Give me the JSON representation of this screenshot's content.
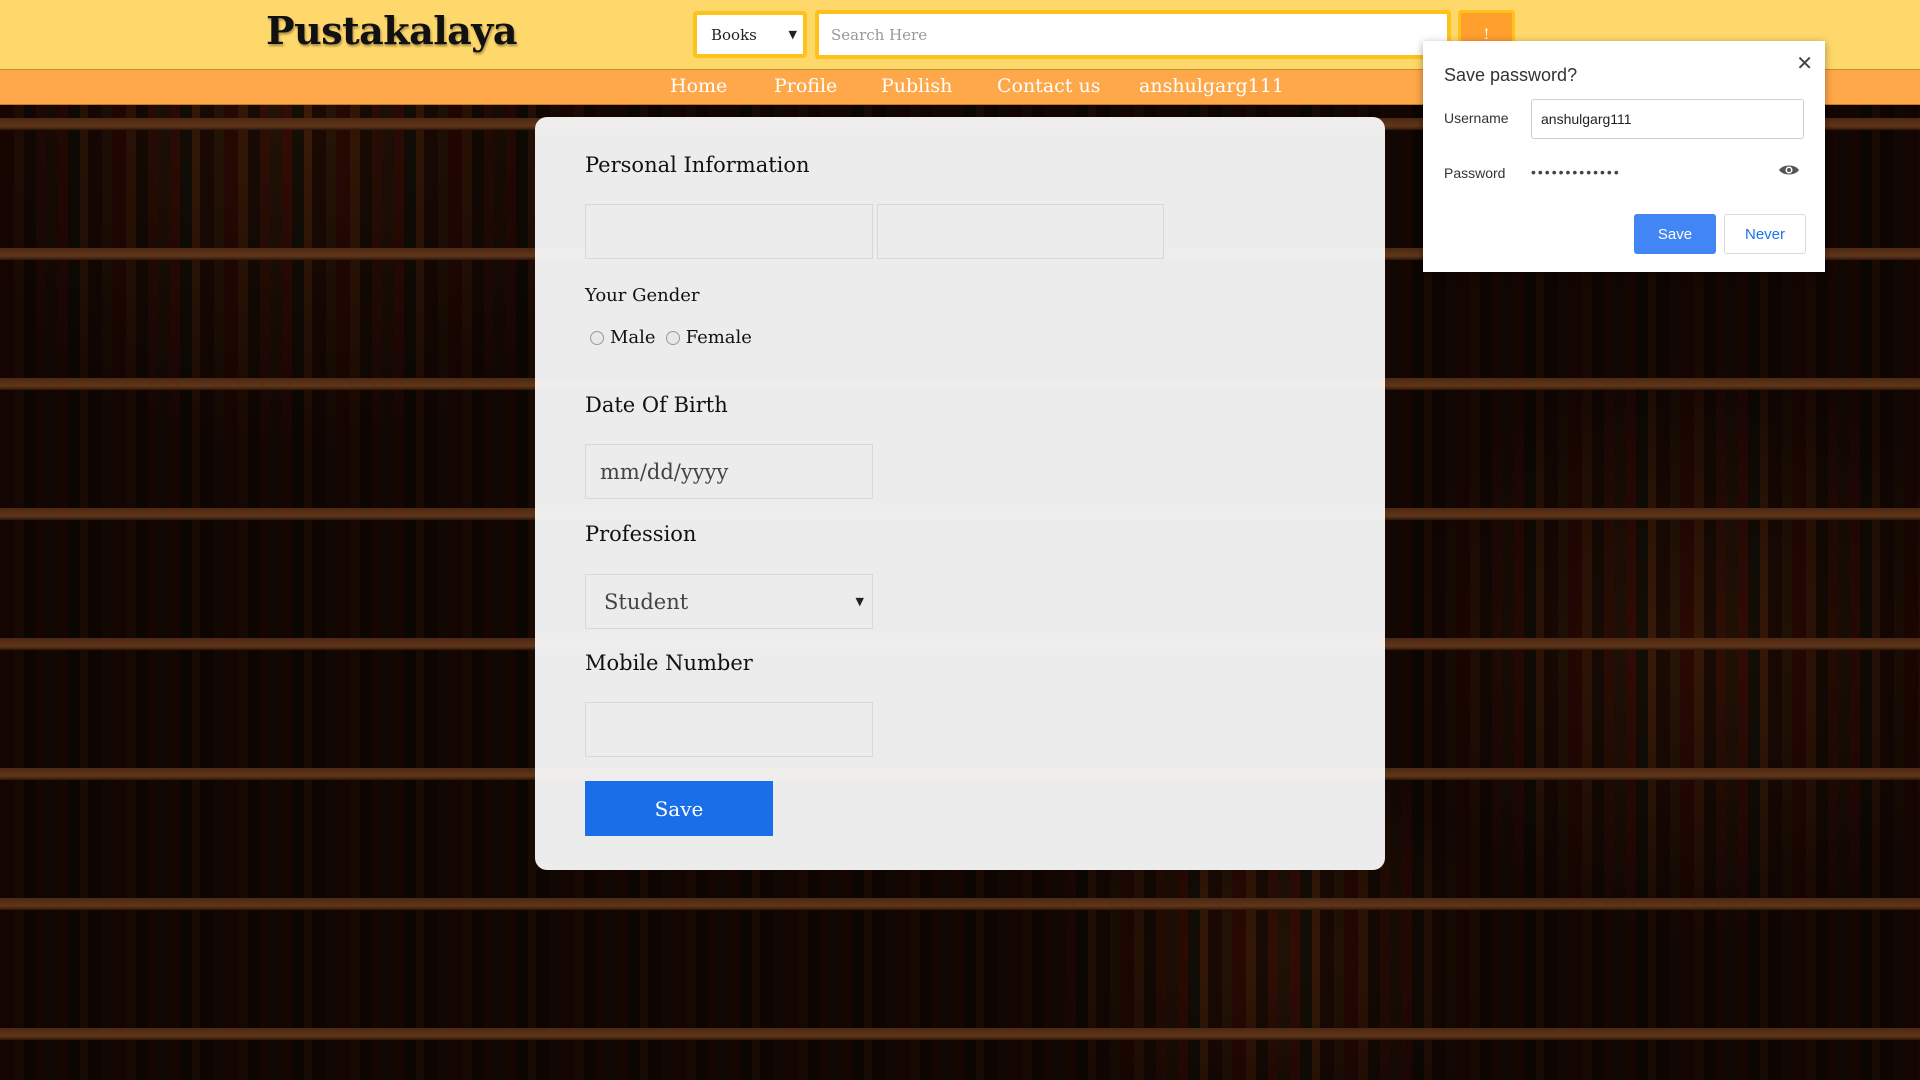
{
  "header": {
    "brand": "Pustakalaya",
    "category": "Books",
    "search_placeholder": "Search Here",
    "search_button": "!"
  },
  "nav": {
    "items": [
      "Home",
      "Profile",
      "Publish",
      "Contact us",
      "anshulgarg111"
    ]
  },
  "form": {
    "section_title": "Personal Information",
    "first_name_value": "",
    "last_name_value": "",
    "gender_label": "Your Gender",
    "gender_options": [
      "Male",
      "Female"
    ],
    "dob_label": "Date Of Birth",
    "dob_placeholder": "mm/dd/yyyy",
    "profession_label": "Profession",
    "profession_value": "Student",
    "mobile_label": "Mobile Number",
    "mobile_value": "",
    "save_label": "Save"
  },
  "password_popup": {
    "title": "Save password?",
    "username_label": "Username",
    "username_value": "anshulgarg111",
    "password_label": "Password",
    "password_value": "•••••••••••••",
    "save_label": "Save",
    "never_label": "Never"
  },
  "colors": {
    "header_bg": "#ffd86b",
    "nav_bg": "#ffa84a",
    "accent_blue": "#1a6fe8",
    "chrome_blue": "#4285f4"
  }
}
